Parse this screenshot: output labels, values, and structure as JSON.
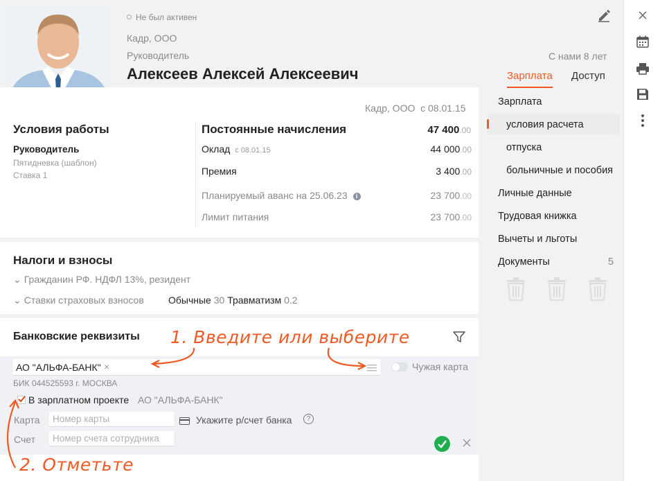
{
  "header": {
    "status": "Не был активен",
    "company": "Кадр, ООО",
    "position": "Руководитель",
    "name": "Алексеев Алексей Алексеевич",
    "tenure": "С нами 8 лет"
  },
  "tabs": [
    {
      "label": "Зарплата",
      "active": true
    },
    {
      "label": "Доступ",
      "active": false
    }
  ],
  "conditions": {
    "org_date": "Кадр, ООО  с 08.01.15",
    "title": "Условия работы",
    "position": "Руководитель",
    "schedule": "Пятидневка (шаблон)",
    "rate": "Ставка 1"
  },
  "accruals": {
    "title": "Постоянные начисления",
    "total": "47 400",
    "total_cents": ".00",
    "rows": [
      {
        "label": "Оклад",
        "sub": "с 08.01.15",
        "value": "44 000",
        "cents": ".00"
      },
      {
        "label": "Премия",
        "sub": "",
        "value": "3 400",
        "cents": ".00"
      },
      {
        "label": "Планируемый аванс на 25.06.23",
        "sub": "",
        "value": "23 700",
        "cents": ".00"
      },
      {
        "label": "Лимит питания",
        "sub": "",
        "value": "23 700",
        "cents": ".00"
      }
    ]
  },
  "taxes": {
    "title": "Налоги и взносы",
    "ndfl": "Гражданин РФ. НДФЛ 13%, резидент",
    "insurance": "Ставки страховых взносов",
    "ordinary_label": "Обычные",
    "ordinary_value": "30",
    "trauma_label": "Травматизм",
    "trauma_value": "0.2"
  },
  "bank": {
    "title": "Банковские реквизиты",
    "bank_value": "АО \"АЛЬФА-БАНК\"",
    "bik": "БИК 044525593 г. МОСКВА",
    "foreign_card": "Чужая карта",
    "salary_project_label": "В зарплатном проекте",
    "salary_project_bank": "АО \"АЛЬФА-БАНК\"",
    "card_label": "Карта",
    "card_placeholder": "Номер карты",
    "account_hint": "Укажите р/счет банка",
    "account_label": "Счет",
    "account_placeholder": "Номер счета сотрудника"
  },
  "annotations": {
    "step1": "1. Введите или выберите",
    "step2": "2. Отметьте"
  },
  "sidebar": {
    "items": [
      {
        "label": "Зарплата"
      },
      {
        "label": "условия расчета",
        "active": true
      },
      {
        "label": "отпуска"
      },
      {
        "label": "больничные и пособия"
      },
      {
        "label": "Личные данные"
      },
      {
        "label": "Трудовая книжка"
      },
      {
        "label": "Вычеты и льготы"
      },
      {
        "label": "Документы",
        "count": "5"
      }
    ]
  },
  "colors": {
    "accent": "#f05a22",
    "success": "#1eae4e"
  }
}
